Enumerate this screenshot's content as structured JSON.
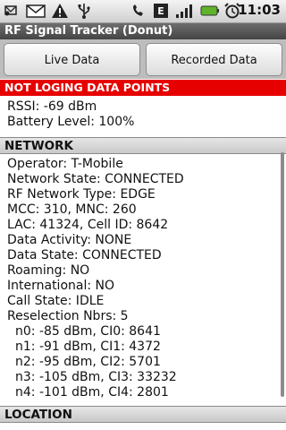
{
  "status_bar": {
    "time": "11:03",
    "icons": [
      "usb-debug-icon",
      "gmail-icon",
      "warning-icon",
      "usb-icon",
      "missed-call-icon",
      "edge-signal-icon",
      "signal-bars-icon",
      "battery-icon",
      "alarm-icon"
    ]
  },
  "app": {
    "title": "RF Signal Tracker (Donut)"
  },
  "buttons": {
    "live": "Live Data",
    "recorded": "Recorded Data"
  },
  "alert": "NOT LOGING DATA POINTS",
  "top_lines": [
    "RSSI: -69 dBm",
    "Battery Level: 100%"
  ],
  "network": {
    "header": "NETWORK",
    "lines": [
      "Operator: T-Mobile",
      "Network State: CONNECTED",
      "RF Network Type: EDGE",
      "MCC: 310, MNC: 260",
      "LAC: 41324, Cell ID: 8642",
      "Data Activity: NONE",
      "Data State: CONNECTED",
      "Roaming: NO",
      "International: NO",
      "Call State: IDLE",
      "Reselection Nbrs: 5"
    ],
    "neighbors": [
      "n0: -85 dBm, CI0: 8641",
      "n1: -91 dBm, CI1: 4372",
      "n2: -95 dBm, CI2: 5701",
      "n3: -105 dBm, CI3: 33232",
      "n4: -101 dBm, CI4: 2801"
    ]
  },
  "location": {
    "header": "LOCATION"
  },
  "colors": {
    "alert": "#e60000",
    "title_bar": "#555555"
  }
}
